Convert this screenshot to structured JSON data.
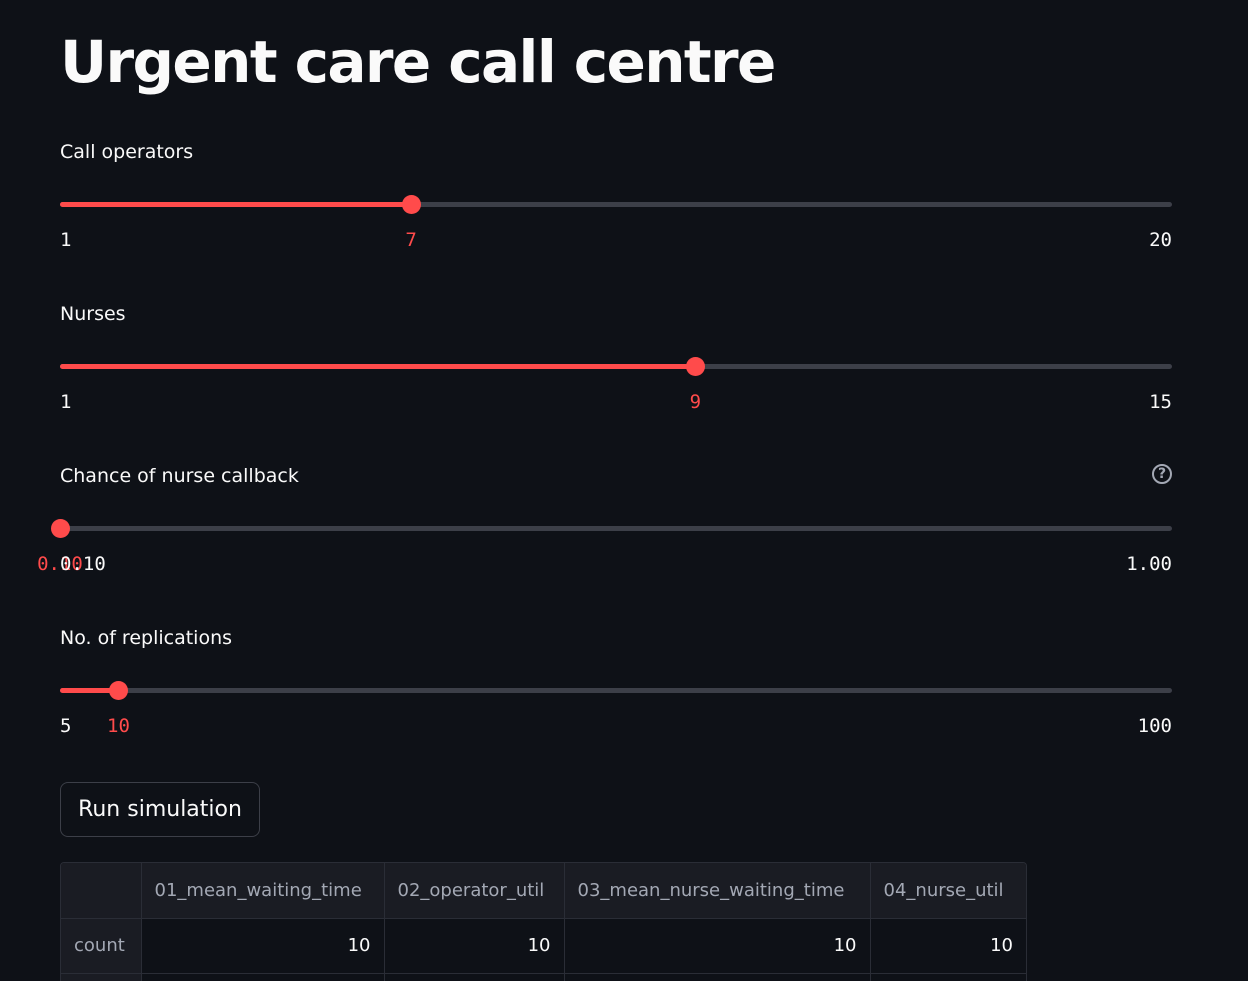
{
  "page": {
    "title": "Urgent care call centre"
  },
  "sliders": [
    {
      "label": "Call operators",
      "value": "7",
      "min": "1",
      "max": "20",
      "fraction": 0.3158,
      "has_help": false
    },
    {
      "label": "Nurses",
      "value": "9",
      "min": "1",
      "max": "15",
      "fraction": 0.5714,
      "has_help": false
    },
    {
      "label": "Chance of nurse callback",
      "value": "0.10",
      "min": "0.10",
      "max": "1.00",
      "fraction": 0.0,
      "has_help": true,
      "help_glyph": "?"
    },
    {
      "label": "No. of replications",
      "value": "10",
      "min": "5",
      "max": "100",
      "fraction": 0.0526,
      "has_help": false
    }
  ],
  "run_button": {
    "label": "Run simulation"
  },
  "results_table": {
    "headers": [
      "",
      "01_mean_waiting_time",
      "02_operator_util",
      "03_mean_nurse_waiting_time",
      "04_nurse_util"
    ],
    "rows": [
      {
        "label": "count",
        "values": [
          "10",
          "10",
          "10",
          "10"
        ]
      }
    ]
  },
  "colors": {
    "background": "#0e1117",
    "accent": "#ff4b4b",
    "track": "#3c3f48",
    "text": "#fafafa",
    "muted_text": "#a3a8b4"
  },
  "icons": {
    "help": "help-circle-icon"
  }
}
